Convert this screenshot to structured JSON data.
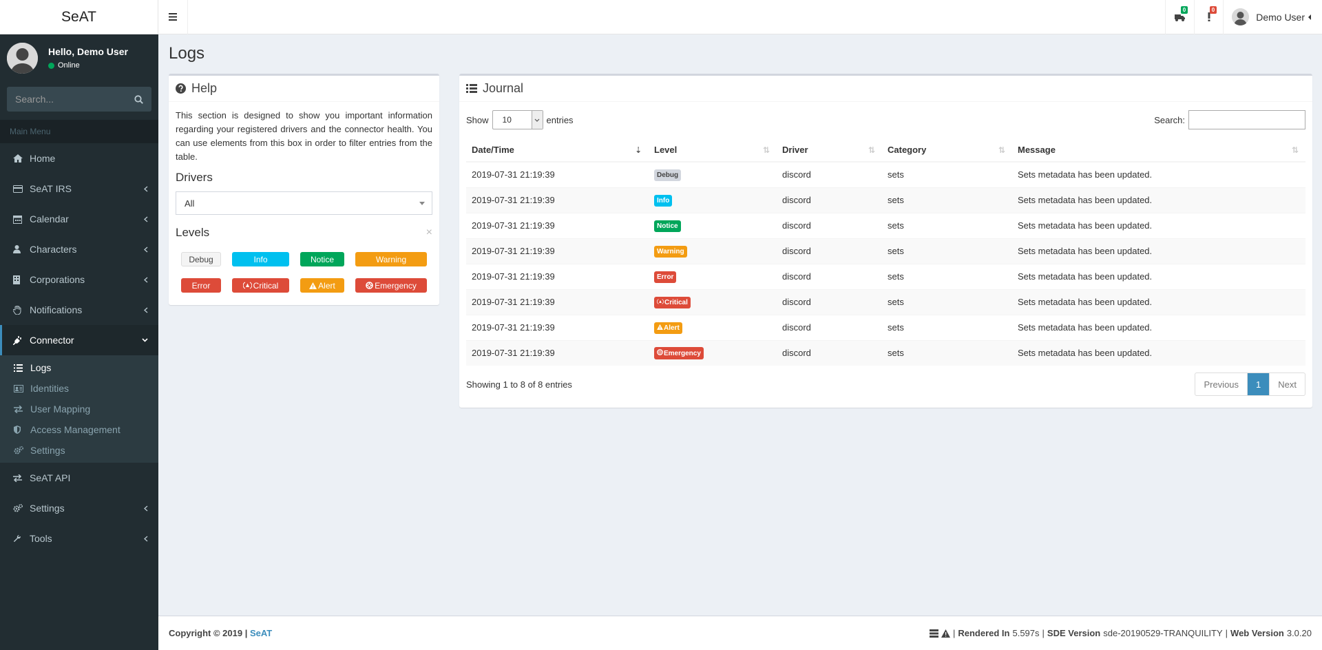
{
  "app": {
    "logo": "SeAT"
  },
  "header": {
    "badges": [
      {
        "icon": "truck-icon",
        "count": "0",
        "color": "#00a65a"
      },
      {
        "icon": "exclamation-icon",
        "count": "0",
        "color": "#dd4b39"
      }
    ],
    "user_name": "Demo User"
  },
  "sidebar": {
    "greeting": "Hello, Demo User",
    "status": "Online",
    "search_placeholder": "Search...",
    "menu_header": "Main Menu",
    "items": [
      {
        "label": "Home",
        "icon": "home-icon"
      },
      {
        "label": "SeAT IRS",
        "icon": "card-icon"
      },
      {
        "label": "Calendar",
        "icon": "calendar-icon"
      },
      {
        "label": "Characters",
        "icon": "user-icon"
      },
      {
        "label": "Corporations",
        "icon": "building-icon"
      },
      {
        "label": "Notifications",
        "icon": "hand-icon"
      },
      {
        "label": "Connector",
        "icon": "plug-icon"
      }
    ],
    "connector_sub": [
      {
        "label": "Logs",
        "icon": "list-icon"
      },
      {
        "label": "Identities",
        "icon": "id-card-icon"
      },
      {
        "label": "User Mapping",
        "icon": "exchange-icon"
      },
      {
        "label": "Access Management",
        "icon": "shield-icon"
      },
      {
        "label": "Settings",
        "icon": "cogs-icon"
      }
    ],
    "items_after": [
      {
        "label": "SeAT API",
        "icon": "exchange-icon"
      },
      {
        "label": "Settings",
        "icon": "cogs-icon"
      },
      {
        "label": "Tools",
        "icon": "wrench-icon"
      }
    ]
  },
  "page": {
    "title": "Logs"
  },
  "help": {
    "title": "Help",
    "text": "This section is designed to show you important information regarding your registered drivers and the connector health. You can use elements from this box in order to filter entries from the table.",
    "drivers_title": "Drivers",
    "drivers_selected": "All",
    "levels_title": "Levels",
    "levels": [
      {
        "label": "Debug",
        "color": "#f4f4f4",
        "text": "#444"
      },
      {
        "label": "Info",
        "color": "#00c0ef",
        "text": "#fff"
      },
      {
        "label": "Notice",
        "color": "#00a65a",
        "text": "#fff"
      },
      {
        "label": "Warning",
        "color": "#f39c12",
        "text": "#fff"
      },
      {
        "label": "Error",
        "color": "#dd4b39",
        "text": "#fff"
      },
      {
        "label": "Critical",
        "color": "#dd4b39",
        "text": "#fff"
      },
      {
        "label": "Alert",
        "color": "#f39c12",
        "text": "#fff"
      },
      {
        "label": "Emergency",
        "color": "#dd4b39",
        "text": "#fff"
      }
    ]
  },
  "journal": {
    "title": "Journal",
    "show_label": "Show",
    "entries_label": "entries",
    "page_length": "10",
    "search_label": "Search:",
    "columns": [
      "Date/Time",
      "Level",
      "Driver",
      "Category",
      "Message"
    ],
    "rows": [
      {
        "datetime": "2019-07-31 21:19:39",
        "level": "Debug",
        "driver": "discord",
        "category": "sets",
        "message": "Sets metadata has been updated."
      },
      {
        "datetime": "2019-07-31 21:19:39",
        "level": "Info",
        "driver": "discord",
        "category": "sets",
        "message": "Sets metadata has been updated."
      },
      {
        "datetime": "2019-07-31 21:19:39",
        "level": "Notice",
        "driver": "discord",
        "category": "sets",
        "message": "Sets metadata has been updated."
      },
      {
        "datetime": "2019-07-31 21:19:39",
        "level": "Warning",
        "driver": "discord",
        "category": "sets",
        "message": "Sets metadata has been updated."
      },
      {
        "datetime": "2019-07-31 21:19:39",
        "level": "Error",
        "driver": "discord",
        "category": "sets",
        "message": "Sets metadata has been updated."
      },
      {
        "datetime": "2019-07-31 21:19:39",
        "level": "Critical",
        "driver": "discord",
        "category": "sets",
        "message": "Sets metadata has been updated."
      },
      {
        "datetime": "2019-07-31 21:19:39",
        "level": "Alert",
        "driver": "discord",
        "category": "sets",
        "message": "Sets metadata has been updated."
      },
      {
        "datetime": "2019-07-31 21:19:39",
        "level": "Emergency",
        "driver": "discord",
        "category": "sets",
        "message": "Sets metadata has been updated."
      }
    ],
    "info": "Showing 1 to 8 of 8 entries",
    "prev": "Previous",
    "current_page": "1",
    "next": "Next"
  },
  "footer": {
    "copyright": "Copyright © 2019 |",
    "brand": "SeAT",
    "rendered_label": "Rendered In",
    "rendered_value": "5.597s",
    "sde_label": "SDE Version",
    "sde_value": "sde-20190529-TRANQUILITY",
    "web_label": "Web Version",
    "web_value": "3.0.20"
  }
}
